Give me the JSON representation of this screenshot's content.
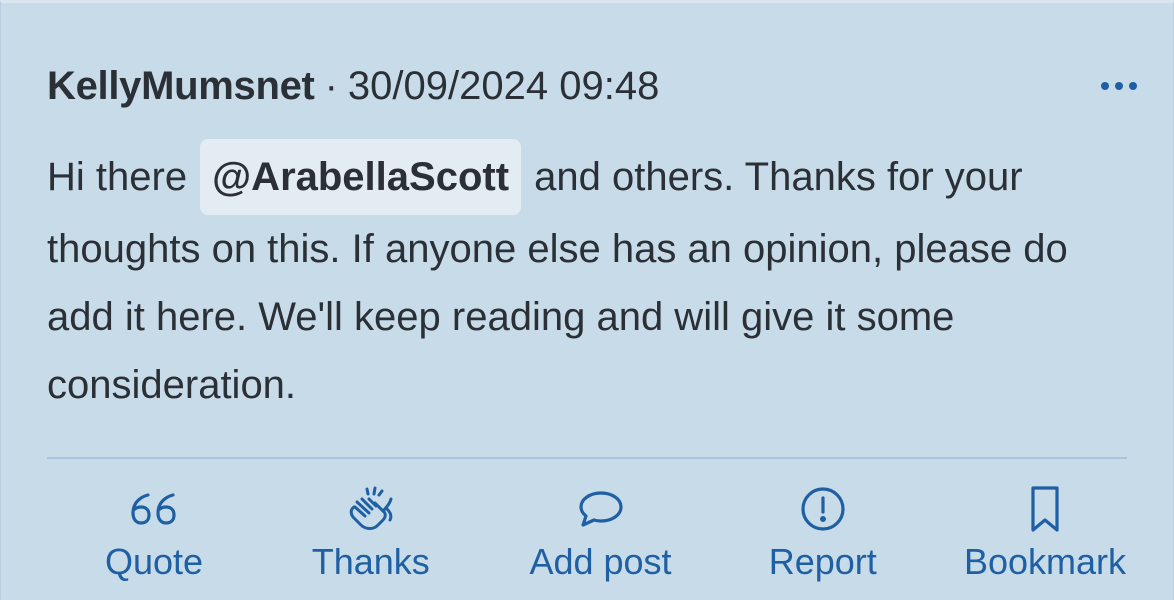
{
  "post": {
    "author": "KellyMumsnet",
    "separator": "·",
    "timestamp": "30/09/2024 09:48",
    "body": {
      "prefix": "Hi there ",
      "mention": "@ArabellaScott",
      "suffix": " and others. Thanks for your thoughts on this. If anyone else has an opinion, please do add it here. We'll keep reading and will give it some consideration."
    }
  },
  "actions": {
    "quote": "Quote",
    "thanks": "Thanks",
    "add_post": "Add post",
    "report": "Report",
    "bookmark": "Bookmark"
  },
  "colors": {
    "background": "#c8dbe9",
    "text": "#2b2f36",
    "accent": "#1f5fa3",
    "mention_bg": "#e3ecf3",
    "divider": "#a9c5dc"
  },
  "icons": {
    "more": "more-horizontal-icon",
    "quote": "quote-marks-icon",
    "thanks": "clapping-hands-icon",
    "add_post": "speech-bubble-icon",
    "report": "exclamation-circle-icon",
    "bookmark": "bookmark-icon"
  }
}
